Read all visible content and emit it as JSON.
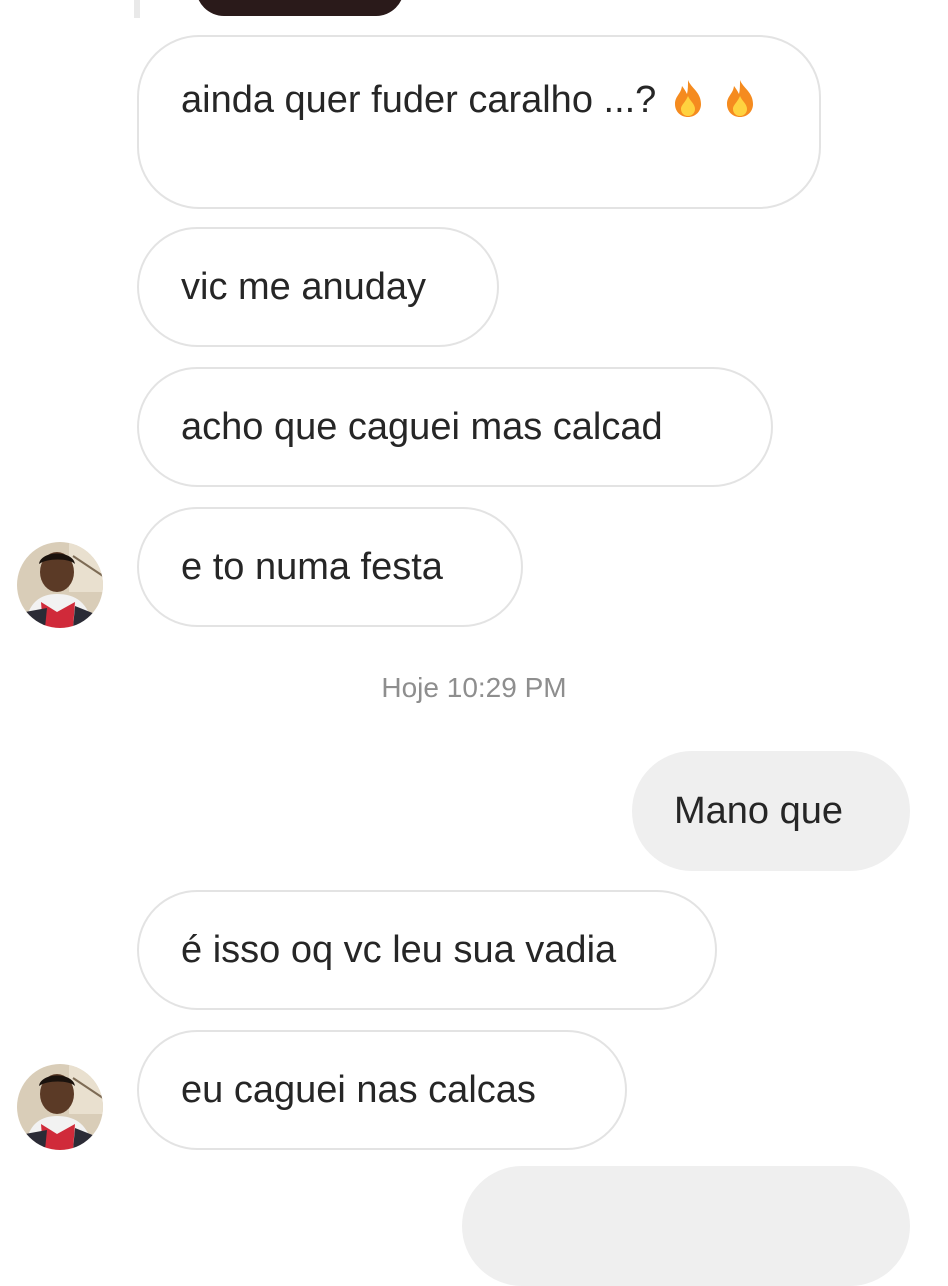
{
  "messages": [
    {
      "text_before": "ainda quer fuder caralho ...?",
      "emoji": "fire-emoji"
    },
    {
      "text": "vic me anuday"
    },
    {
      "text": "acho que caguei mas calcad"
    },
    {
      "text": "e to numa festa"
    },
    {
      "text": "Mano que"
    },
    {
      "text": "é isso oq vc leu sua vadia"
    },
    {
      "text": "eu caguei nas calcas"
    }
  ],
  "timestamp": "Hoje 10:29 PM",
  "colors": {
    "incoming_bubble_bg": "#ffffff",
    "incoming_bubble_border": "#e3e3e3",
    "outgoing_bubble_bg": "#efefef",
    "timestamp_text": "#8e8e8e",
    "message_text": "#262626"
  }
}
